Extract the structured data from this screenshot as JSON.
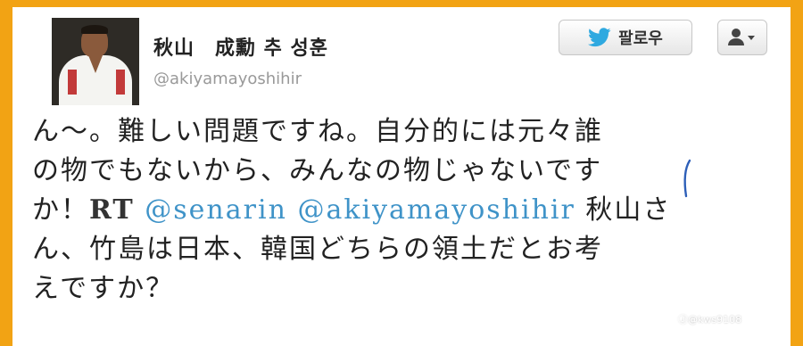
{
  "profile": {
    "name": "秋山　成勳 추 성훈",
    "handle": "@akiyamayoshihir"
  },
  "actions": {
    "follow_label": "팔로우",
    "user_menu_icon": "person-caret-icon"
  },
  "tweet": {
    "line1": "ん～。難しい問題ですね。自分的には元々誰",
    "line2": "の物でもないから、みんなの物じゃないです",
    "line3_prefix": "か！",
    "rt": "RT",
    "mention1": "@senarin",
    "mention2": "@akiyamayoshihir",
    "line3_suffix": "秋山さ",
    "line4": "ん、竹島は日本、韓国どちらの領土だとお考",
    "line5": "えですか？"
  },
  "watermark": "Ⓙ@kws9108",
  "colors": {
    "frame": "#f2a314",
    "mention": "#3f93c8",
    "twitter_blue": "#2fa9e0"
  }
}
